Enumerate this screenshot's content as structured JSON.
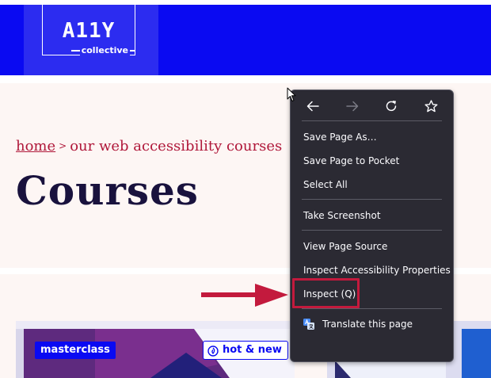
{
  "header": {
    "logo_main": "A11Y",
    "logo_sub": "collective"
  },
  "breadcrumb": {
    "home": "home",
    "separator": ">",
    "current": "our web accessibility courses"
  },
  "page_title": "Courses",
  "cards": [
    {
      "badge": "masterclass",
      "tag": "hot & new"
    }
  ],
  "context_menu": {
    "nav": {
      "back": "arrow-left-icon",
      "forward": "arrow-right-icon",
      "reload": "reload-icon",
      "bookmark": "star-icon"
    },
    "items": [
      {
        "label": "Save Page As…"
      },
      {
        "label": "Save Page to Pocket"
      },
      {
        "label": "Select All"
      },
      {
        "label": "Take Screenshot"
      },
      {
        "label": "View Page Source"
      },
      {
        "label": "Inspect Accessibility Properties"
      },
      {
        "label": "Inspect (Q)"
      },
      {
        "label": "Translate this page"
      }
    ]
  },
  "colors": {
    "header_blue": "#0a0af2",
    "hero_bg": "#fdf6f4",
    "breadcrumb_red": "#b0183a",
    "title_navy": "#19123d",
    "menu_bg": "#2b2a33",
    "annotation_red": "#c31a3d"
  }
}
